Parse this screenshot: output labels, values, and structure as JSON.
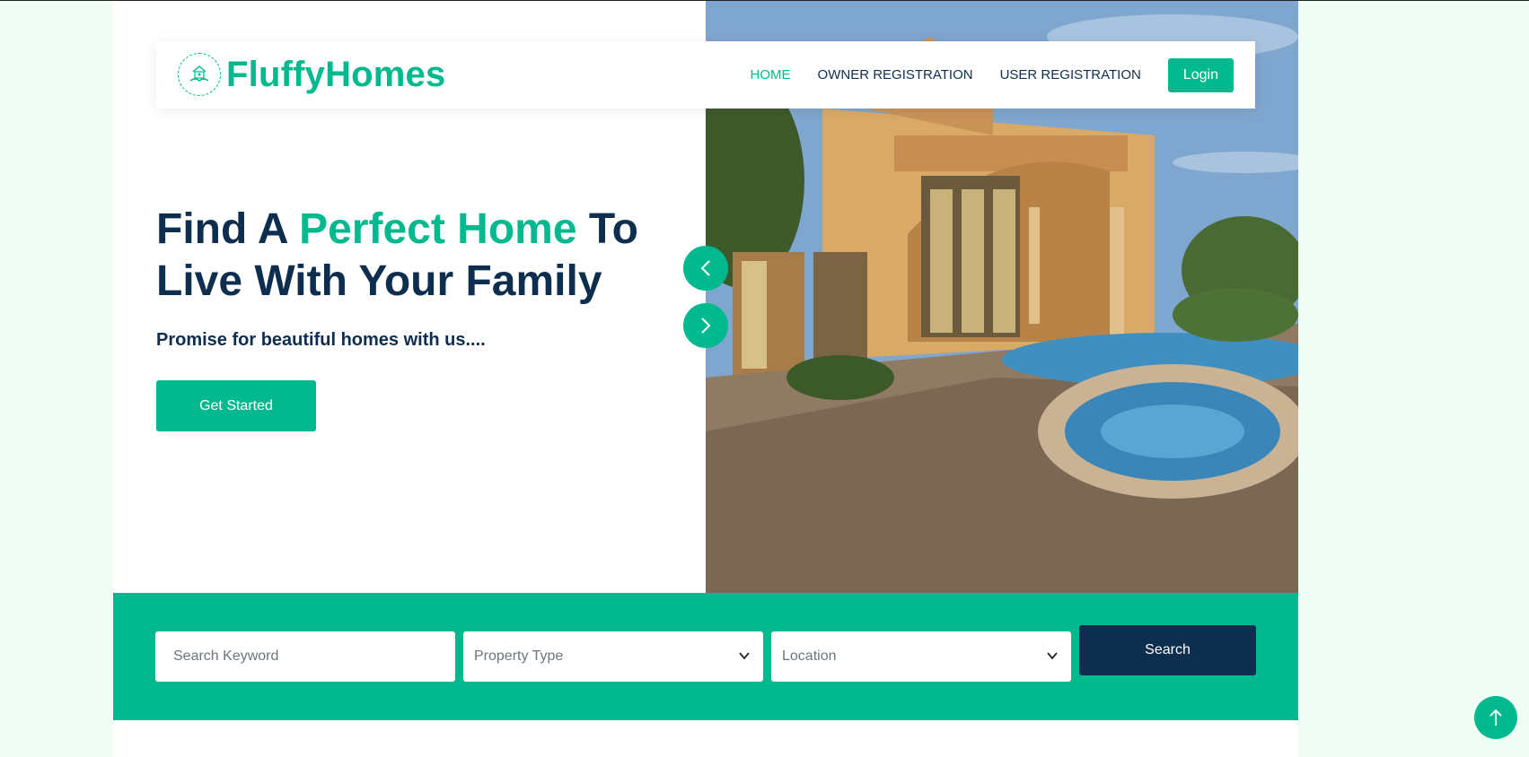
{
  "brand": {
    "name": "FluffyHomes",
    "logo_icon": "house-handshake-icon"
  },
  "nav": {
    "items": [
      {
        "label": "HOME",
        "active": true
      },
      {
        "label": "OWNER REGISTRATION",
        "active": false
      },
      {
        "label": "USER REGISTRATION",
        "active": false
      }
    ],
    "login_label": "Login"
  },
  "hero": {
    "title_part1": "Find A ",
    "title_accent": "Perfect Home",
    "title_part2": " To Live With Your Family",
    "subtitle": "Promise for beautiful homes with us....",
    "cta_label": "Get Started",
    "image_alt": "luxury-house-with-pool-photo",
    "prev_icon": "chevron-left-icon",
    "next_icon": "chevron-right-icon"
  },
  "search": {
    "keyword_placeholder": "Search Keyword",
    "property_type_selected": "Property Type",
    "location_selected": "Location",
    "button_label": "Search"
  },
  "back_to_top_icon": "arrow-up-icon",
  "colors": {
    "accent": "#00b98e",
    "dark": "#0e2e50",
    "page_bg": "#effdf4"
  }
}
